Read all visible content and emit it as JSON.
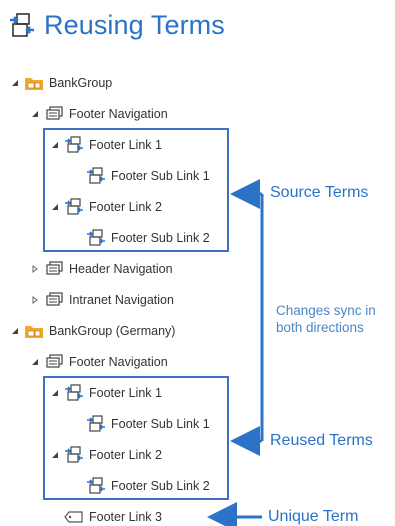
{
  "page": {
    "title": "Reusing Terms"
  },
  "tree": {
    "bankgroup": "BankGroup",
    "footer_navigation": "Footer Navigation",
    "footer_link_1": "Footer Link 1",
    "footer_sub_link_1": "Footer Sub Link 1",
    "footer_link_2": "Footer Link 2",
    "footer_sub_link_2": "Footer Sub Link 2",
    "header_navigation": "Header Navigation",
    "intranet_navigation": "Intranet Navigation",
    "bankgroup_germany": "BankGroup (Germany)",
    "footer_navigation_2": "Footer Navigation",
    "footer_link_1_b": "Footer Link 1",
    "footer_sub_link_1_b": "Footer Sub Link 1",
    "footer_link_2_b": "Footer Link 2",
    "footer_sub_link_2_b": "Footer Sub Link 2",
    "footer_link_3": "Footer Link 3"
  },
  "callouts": {
    "source": "Source Terms",
    "reused": "Reused Terms",
    "unique": "Unique Term",
    "sync_line1": "Changes sync in",
    "sync_line2": "both directions"
  },
  "colors": {
    "accent": "#2a73c7",
    "box": "#3f6fbf",
    "folder": "#f0a830"
  },
  "icons": {
    "title": "reused-term-icon",
    "group": "folder-group-icon",
    "termset": "term-set-icon",
    "reused_term": "reused-term-icon",
    "term": "term-icon"
  }
}
